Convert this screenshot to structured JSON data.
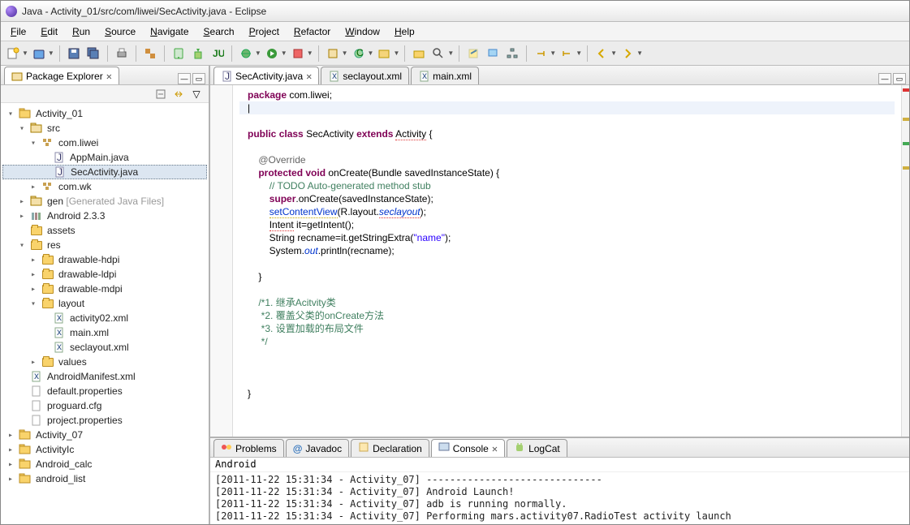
{
  "window": {
    "title": "Java - Activity_01/src/com/liwei/SecActivity.java - Eclipse"
  },
  "menubar": [
    "File",
    "Edit",
    "Run",
    "Source",
    "Navigate",
    "Search",
    "Project",
    "Refactor",
    "Window",
    "Help"
  ],
  "package_explorer": {
    "title": "Package Explorer"
  },
  "tree": [
    {
      "d": 0,
      "e": "-",
      "t": "proj",
      "l": "Activity_01"
    },
    {
      "d": 1,
      "e": "-",
      "t": "src",
      "l": "src"
    },
    {
      "d": 2,
      "e": "-",
      "t": "pkg",
      "l": "com.liwei"
    },
    {
      "d": 3,
      "e": " ",
      "t": "java",
      "l": "AppMain.java"
    },
    {
      "d": 3,
      "e": " ",
      "t": "java",
      "l": "SecActivity.java",
      "sel": true
    },
    {
      "d": 2,
      "e": "+",
      "t": "pkg",
      "l": "com.wk"
    },
    {
      "d": 1,
      "e": "+",
      "t": "src",
      "l": "gen",
      "suffix": " [Generated Java Files]"
    },
    {
      "d": 1,
      "e": "+",
      "t": "lib",
      "l": "Android 2.3.3"
    },
    {
      "d": 1,
      "e": " ",
      "t": "folder",
      "l": "assets"
    },
    {
      "d": 1,
      "e": "-",
      "t": "folder",
      "l": "res"
    },
    {
      "d": 2,
      "e": "+",
      "t": "folder",
      "l": "drawable-hdpi"
    },
    {
      "d": 2,
      "e": "+",
      "t": "folder",
      "l": "drawable-ldpi"
    },
    {
      "d": 2,
      "e": "+",
      "t": "folder",
      "l": "drawable-mdpi"
    },
    {
      "d": 2,
      "e": "-",
      "t": "folder",
      "l": "layout"
    },
    {
      "d": 3,
      "e": " ",
      "t": "xml",
      "l": "activity02.xml"
    },
    {
      "d": 3,
      "e": " ",
      "t": "xml",
      "l": "main.xml"
    },
    {
      "d": 3,
      "e": " ",
      "t": "xml",
      "l": "seclayout.xml"
    },
    {
      "d": 2,
      "e": "+",
      "t": "folder",
      "l": "values"
    },
    {
      "d": 1,
      "e": " ",
      "t": "xml",
      "l": "AndroidManifest.xml"
    },
    {
      "d": 1,
      "e": " ",
      "t": "file",
      "l": "default.properties"
    },
    {
      "d": 1,
      "e": " ",
      "t": "file",
      "l": "proguard.cfg"
    },
    {
      "d": 1,
      "e": " ",
      "t": "file",
      "l": "project.properties"
    },
    {
      "d": 0,
      "e": "+",
      "t": "proj",
      "l": "Activity_07"
    },
    {
      "d": 0,
      "e": "+",
      "t": "proj",
      "l": "ActivityIc"
    },
    {
      "d": 0,
      "e": "+",
      "t": "proj",
      "l": "Android_calc"
    },
    {
      "d": 0,
      "e": "+",
      "t": "proj",
      "l": "android_list"
    }
  ],
  "editor_tabs": [
    {
      "label": "SecActivity.java",
      "icon": "java",
      "active": true,
      "close": true
    },
    {
      "label": "seclayout.xml",
      "icon": "xml",
      "active": false,
      "close": false
    },
    {
      "label": "main.xml",
      "icon": "xml",
      "active": false,
      "close": false
    }
  ],
  "code": {
    "package_kw": "package",
    "package_name": "com.liwei;",
    "class_decl": {
      "public": "public",
      "class": "class",
      "name": "SecActivity",
      "extends": "extends",
      "supercls": "Activity",
      "brace": "{"
    },
    "override": "@Override",
    "method": {
      "protected": "protected",
      "void": "void",
      "name": "onCreate",
      "params": "(Bundle savedInstanceState) {"
    },
    "todo": "// TODO Auto-generated method stub",
    "super_kw": "super",
    "super_call": ".onCreate(savedInstanceState);",
    "scv_fn": "setContentView",
    "scv_args": "(R.layout.",
    "scv_field": "seclayout",
    "scv_end": ");",
    "intent_type": "Intent",
    "intent_rest": " it=getIntent();",
    "string_line": "String recname=it.getStringExtra(",
    "string_lit": "\"name\"",
    "string_end": ");",
    "sys": "System.",
    "out": "out",
    "println": ".println(recname);",
    "close_method": "}",
    "comment_block": [
      "/*1. 继承Acitvity类",
      " *2. 覆盖父类的onCreate方法",
      " *3. 设置加载的布局文件",
      " */"
    ],
    "close_class": "}"
  },
  "bottom_tabs": [
    {
      "label": "Problems",
      "icon": "problems"
    },
    {
      "label": "Javadoc",
      "icon": "javadoc"
    },
    {
      "label": "Declaration",
      "icon": "decl"
    },
    {
      "label": "Console",
      "icon": "console",
      "active": true,
      "close": true
    },
    {
      "label": "LogCat",
      "icon": "logcat"
    }
  ],
  "console": {
    "title": "Android",
    "lines": [
      "[2011-11-22 15:31:34 - Activity_07] ------------------------------",
      "[2011-11-22 15:31:34 - Activity_07] Android Launch!",
      "[2011-11-22 15:31:34 - Activity_07] adb is running normally.",
      "[2011-11-22 15:31:34 - Activity_07] Performing mars.activity07.RadioTest activity launch"
    ]
  }
}
